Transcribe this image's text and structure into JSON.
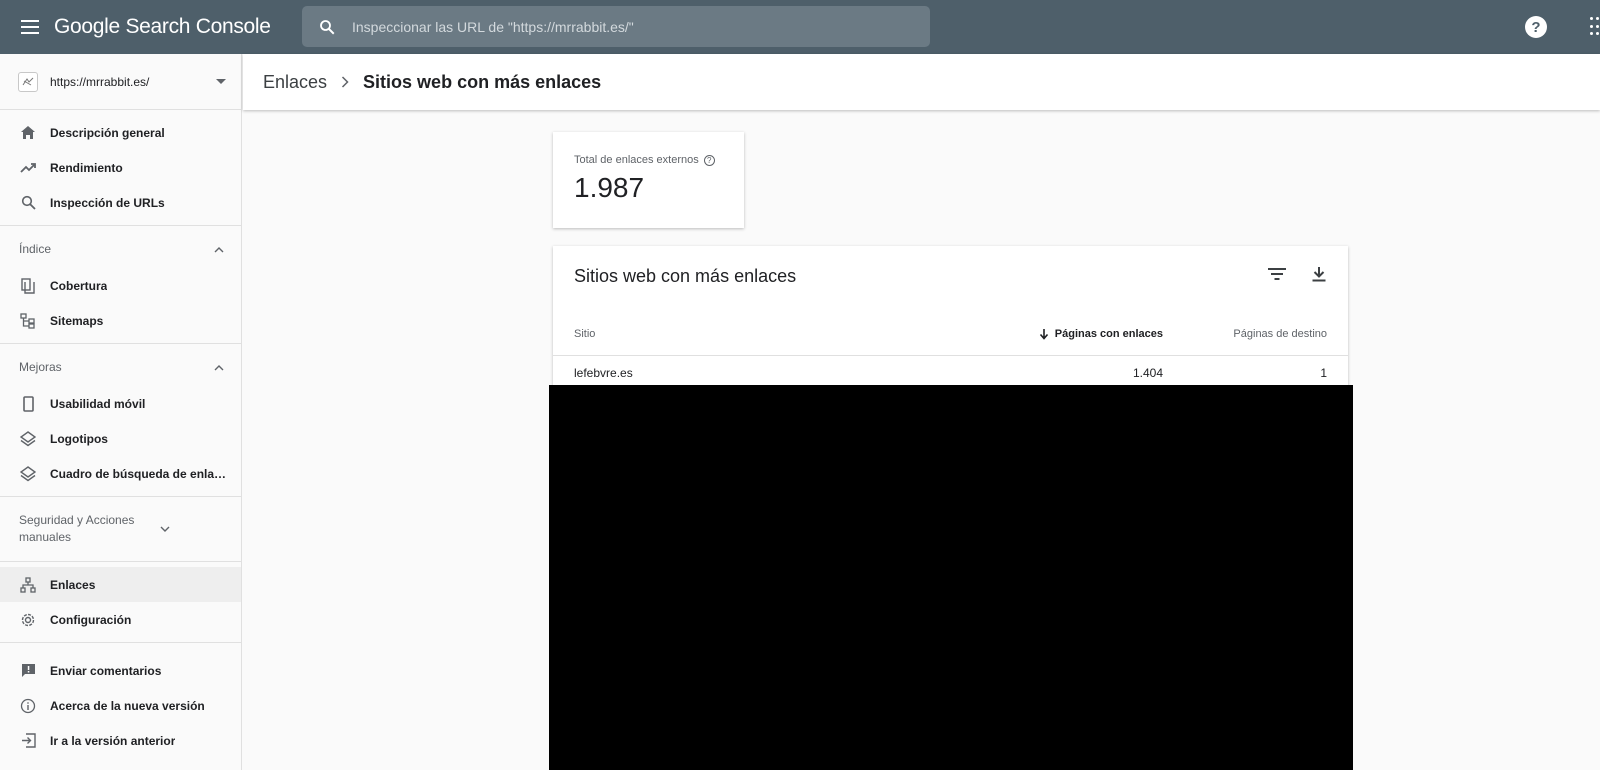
{
  "app": {
    "title": "Google Search Console"
  },
  "search": {
    "placeholder": "Inspeccionar las URL de \"https://mrrabbit.es/\""
  },
  "topbar": {
    "help_icon": "help-icon",
    "apps_icon": "apps-icon"
  },
  "property": {
    "url": "https://mrrabbit.es/"
  },
  "sidebar": {
    "main_items": [
      {
        "label": "Descripción general",
        "icon": "home-icon"
      },
      {
        "label": "Rendimiento",
        "icon": "trending-up-icon"
      },
      {
        "label": "Inspección de URLs",
        "icon": "search-icon"
      }
    ],
    "sections": [
      {
        "title": "Índice",
        "expanded": true,
        "items": [
          {
            "label": "Cobertura",
            "icon": "file-copy-icon"
          },
          {
            "label": "Sitemaps",
            "icon": "sitemap-icon"
          }
        ]
      },
      {
        "title": "Mejoras",
        "expanded": true,
        "items": [
          {
            "label": "Usabilidad móvil",
            "icon": "phone-icon"
          },
          {
            "label": "Logotipos",
            "icon": "layers-icon"
          },
          {
            "label": "Cuadro de búsqueda de enlaces de sitio",
            "icon": "layers-icon"
          }
        ]
      },
      {
        "title": "Seguridad y Acciones manuales",
        "expanded": false,
        "items": []
      }
    ],
    "bottom_items": [
      {
        "label": "Enlaces",
        "icon": "links-icon",
        "active": true
      },
      {
        "label": "Configuración",
        "icon": "gear-icon"
      }
    ],
    "footer_items": [
      {
        "label": "Enviar comentarios",
        "icon": "feedback-icon"
      },
      {
        "label": "Acerca de la nueva versión",
        "icon": "info-icon"
      },
      {
        "label": "Ir a la versión anterior",
        "icon": "exit-icon"
      }
    ]
  },
  "breadcrumb": {
    "parent": "Enlaces",
    "current": "Sitios web con más enlaces"
  },
  "summary": {
    "label": "Total de enlaces externos",
    "value": "1.987"
  },
  "table": {
    "title": "Sitios web con más enlaces",
    "columns": {
      "site": "Sitio",
      "linking_pages": "Páginas con enlaces",
      "target_pages": "Páginas de destino"
    },
    "sorted_column": "linking_pages",
    "rows": [
      {
        "site": "lefebvre.es",
        "linking_pages": "1.404",
        "target_pages": "1"
      }
    ]
  },
  "colors": {
    "topbar": "#4e5f6a",
    "search_bg": "#6b7a84",
    "active_item_bg": "#eeeeee"
  }
}
